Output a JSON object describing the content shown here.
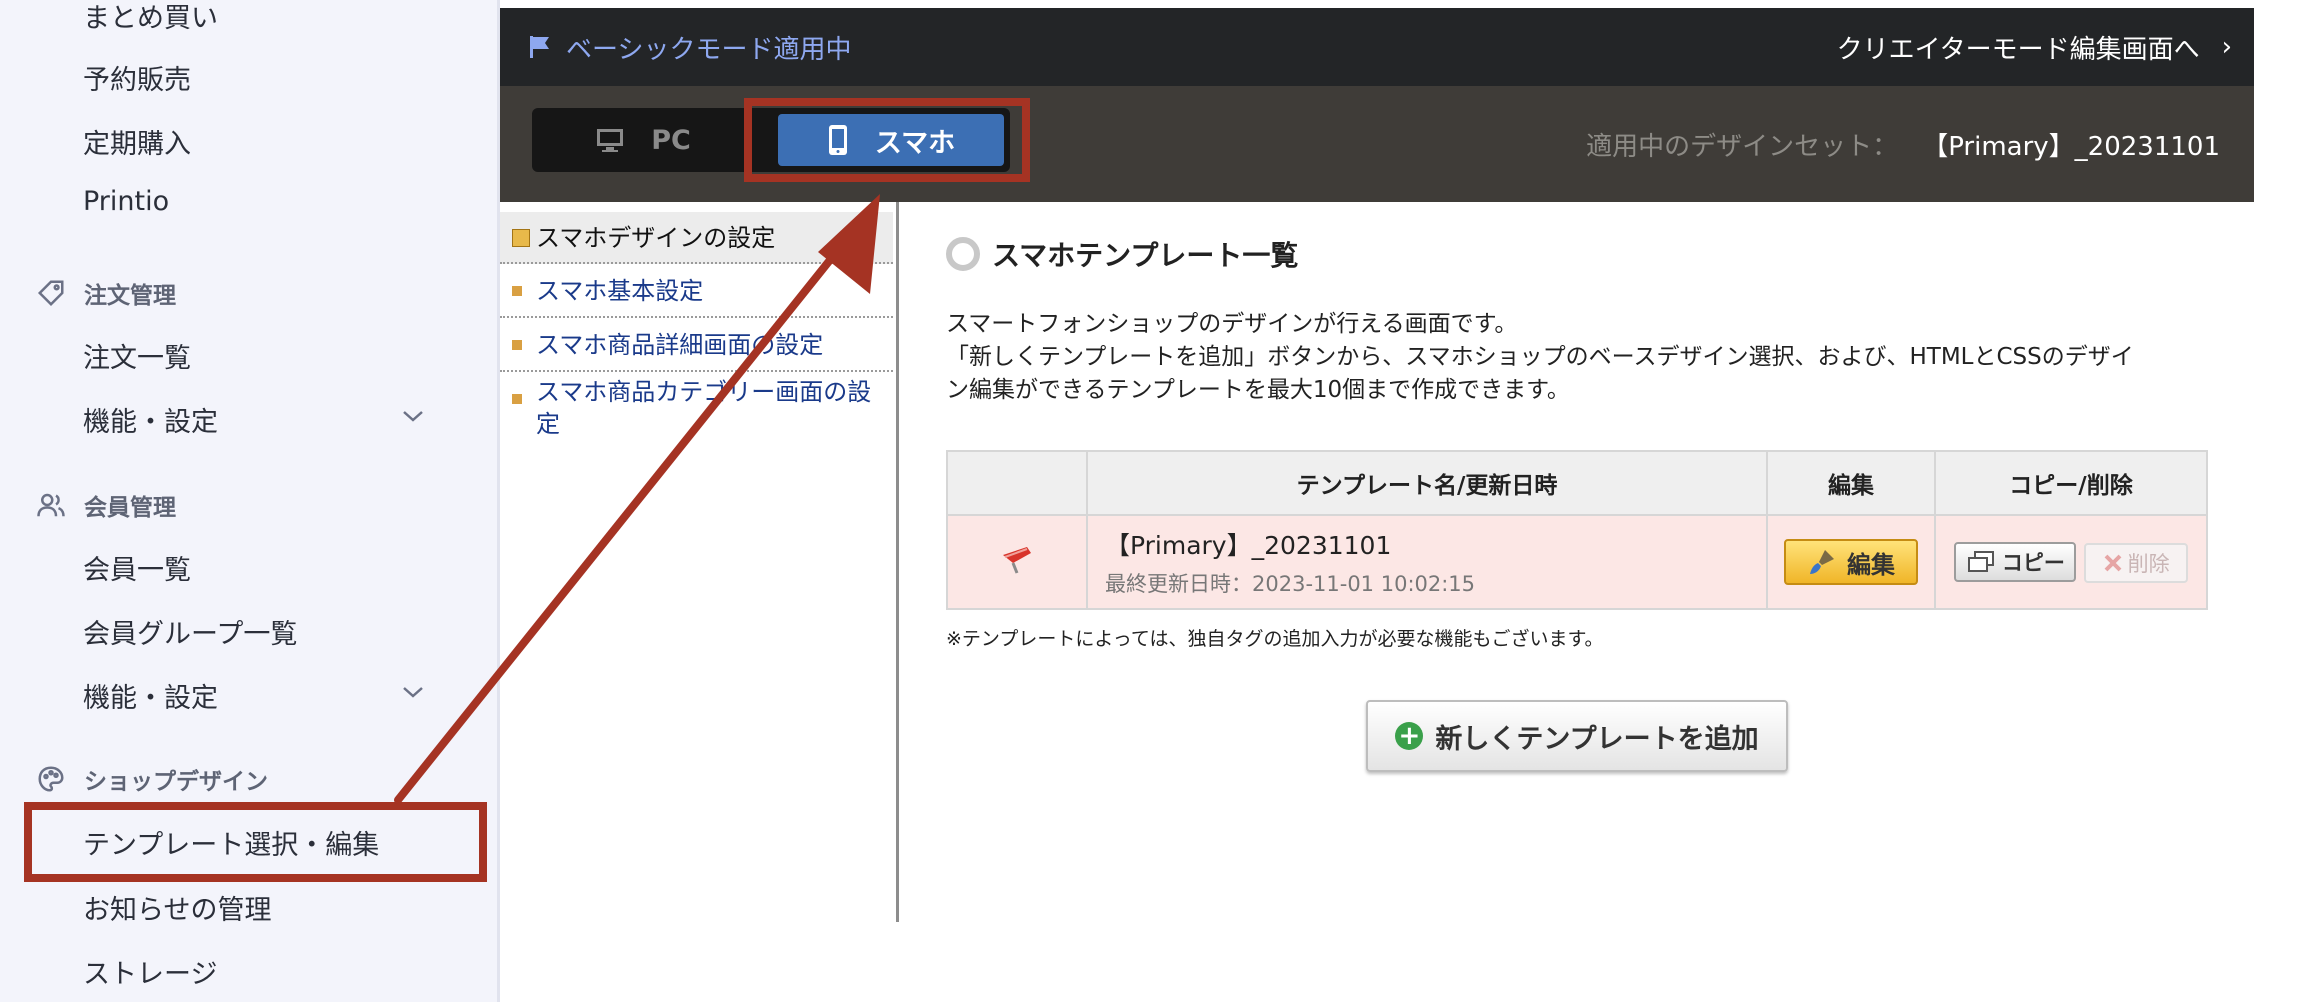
{
  "sidebar": {
    "items_top": [
      "まとめ買い",
      "予約販売",
      "定期購入",
      "Printio"
    ],
    "order": {
      "section": "注文管理",
      "items": [
        "注文一覧",
        "機能・設定"
      ]
    },
    "member": {
      "section": "会員管理",
      "items": [
        "会員一覧",
        "会員グループ一覧",
        "機能・設定"
      ]
    },
    "design": {
      "section": "ショップデザイン",
      "items": [
        "テンプレート選択・編集",
        "お知らせの管理",
        "ストレージ"
      ]
    }
  },
  "topbar": {
    "mode_label": "ベーシックモード適用中",
    "creator_link": "クリエイターモード編集画面へ",
    "creator_chevron": "›"
  },
  "device_switch": {
    "pc_label": "PC",
    "sp_label": "スマホ",
    "selected": "スマホ"
  },
  "design_set": {
    "label": "適用中のデザインセット：",
    "value": "【Primary】_20231101"
  },
  "subnav": [
    "スマホデザインの設定",
    "スマホ基本設定",
    "スマホ商品詳細画面の設定",
    "スマホ商品カテゴリー画面の設定"
  ],
  "subnav_active": "スマホデザインの設定",
  "main": {
    "title": "スマホテンプレート一覧",
    "desc_line1": "スマートフォンショップのデザインが行える画面です。",
    "desc_line2": "「新しくテンプレートを追加」ボタンから、スマホショップのベースデザイン選択、および、HTMLとCSSのデザイ",
    "desc_line3": "ン編集ができるテンプレートを最大10個まで作成できます。",
    "table": {
      "headers": [
        "",
        "テンプレート名/更新日時",
        "編集",
        "コピー/削除"
      ],
      "rows": [
        {
          "name": "【Primary】_20231101",
          "updated": "最終更新日時：2023-11-01 10:02:15",
          "edit_label": "編集",
          "copy_label": "コピー",
          "delete_label": "削除"
        }
      ]
    },
    "note": "※テンプレートによっては、独自タグの追加入力が必要な機能もございます。",
    "add_button": "新しくテンプレートを追加"
  },
  "icons": [
    "flag-icon",
    "monitor-icon",
    "smartphone-icon",
    "tag-icon",
    "users-icon",
    "palette-icon",
    "chevron-down-icon",
    "brush-icon",
    "copy-icon",
    "x-icon",
    "plus-icon",
    "pin-icon"
  ],
  "colors": {
    "annotation": "#a53323",
    "topbar": "#232527",
    "subbar": "#3f3c38",
    "selected_device": "#3c6fb4"
  }
}
